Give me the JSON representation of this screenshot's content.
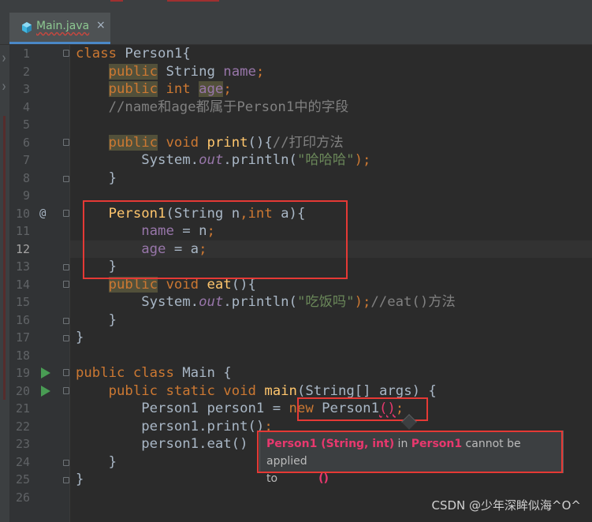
{
  "tab": {
    "file_name": "Main.java",
    "close_glyph": "×"
  },
  "editor": {
    "current_line": 12,
    "lines": [
      {
        "n": "1"
      },
      {
        "n": "2"
      },
      {
        "n": "3"
      },
      {
        "n": "4"
      },
      {
        "n": "5"
      },
      {
        "n": "6"
      },
      {
        "n": "7"
      },
      {
        "n": "8"
      },
      {
        "n": "9"
      },
      {
        "n": "10"
      },
      {
        "n": "11"
      },
      {
        "n": "12"
      },
      {
        "n": "13"
      },
      {
        "n": "14"
      },
      {
        "n": "15"
      },
      {
        "n": "16"
      },
      {
        "n": "17"
      },
      {
        "n": "18"
      },
      {
        "n": "19"
      },
      {
        "n": "20"
      },
      {
        "n": "21"
      },
      {
        "n": "22"
      },
      {
        "n": "23"
      },
      {
        "n": "24"
      },
      {
        "n": "25"
      },
      {
        "n": "26"
      }
    ],
    "override_marker": "@",
    "code": {
      "l1_class": "class",
      "l1_name": " Person1{",
      "l2_public": "public",
      "l2_type": " String ",
      "l2_field": "name",
      "l2_semi": ";",
      "l3_public": "public",
      "l3_type": " int ",
      "l3_field": "age",
      "l3_semi": ";",
      "l4_comment": "//name和age都属于Person1中的字段",
      "l6_public": "public",
      "l6_void": " void ",
      "l6_method": "print",
      "l6_rest": "(){",
      "l6_comment": "//打印方法",
      "l7_sys": "System.",
      "l7_out": "out",
      "l7_call": ".println(",
      "l7_str": "\"哈哈哈\"",
      "l7_end": ");",
      "l8": "}",
      "l10_ctor": "Person1",
      "l10_a": "(String n",
      "l10_comma": ",",
      "l10_int": "int",
      "l10_b": " a){",
      "l11_field": "name",
      "l11_rest": " = n",
      "l11_semi": ";",
      "l12_field": "age",
      "l12_rest": " = a",
      "l12_semi": ";",
      "l13": "}",
      "l14_public": "public",
      "l14_void": " void ",
      "l14_method": "eat",
      "l14_rest": "(){",
      "l15_sys": "System.",
      "l15_out": "out",
      "l15_call": ".println(",
      "l15_str": "\"吃饭吗\"",
      "l15_end": ");",
      "l15_comment": "//eat()方法",
      "l16": "}",
      "l17": "}",
      "l19_public": "public",
      "l19_class": " class ",
      "l19_name": "Main {",
      "l20_mods": "public static void ",
      "l20_method": "main",
      "l20_rest": "(String[] args) {",
      "l21_decl": "Person1 person1 = ",
      "l21_new": "new",
      "l21_ctor": " Person1",
      "l21_parens": "()",
      "l21_semi": ";",
      "l22": "person1.print()",
      "l22_semi": ";",
      "l23": "person1.eat()",
      "l24": "}",
      "l25": "}"
    }
  },
  "tooltip": {
    "sig": "Person1 (String, int)",
    "in": " in ",
    "cls": "Person1",
    "msg": " cannot be applied",
    "to": "to",
    "args": "()"
  },
  "watermark": "CSDN @少年深眸似海^O^",
  "colors": {
    "background": "#2b2b2b",
    "gutter": "#313335",
    "keyword": "#cc7832",
    "field": "#9876aa",
    "method": "#ffc66d",
    "string": "#6a8759",
    "comment": "#808080",
    "annotation_box": "#e53935",
    "error_text": "#e8386e"
  }
}
